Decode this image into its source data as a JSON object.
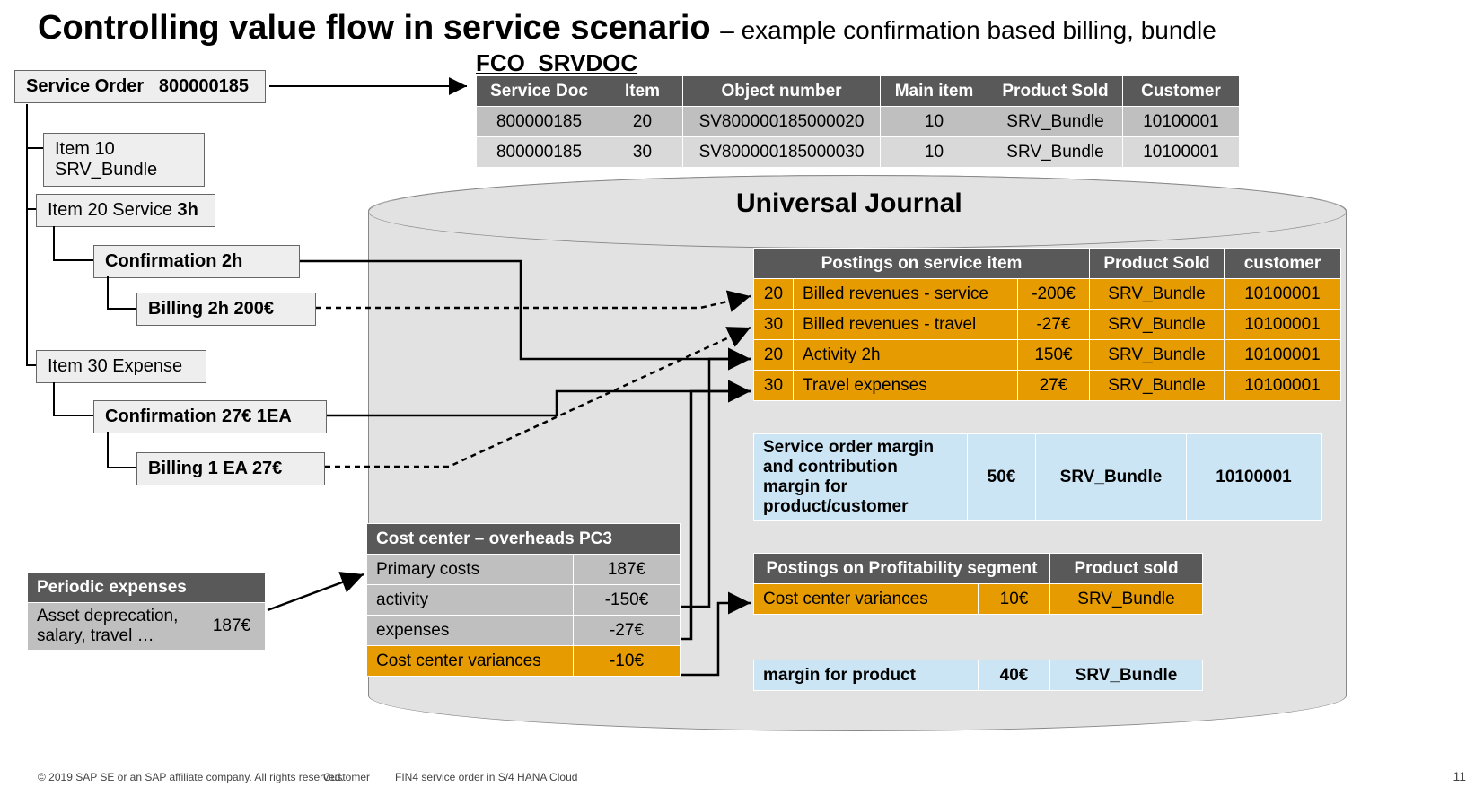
{
  "slide": {
    "title_main": "Controlling value flow in service scenario",
    "title_sub": "– example confirmation based billing, bundle",
    "service_order_label": "Service Order",
    "service_order_number": "800000185",
    "item10": "Item 10 SRV_Bundle",
    "item20_prefix": "Item 20   Service ",
    "item20_bold": "3h",
    "conf1": "Confirmation  2h",
    "bill1": "Billing 2h  200€",
    "item30": "Item 30   Expense",
    "conf2": "Confirmation  27€ 1EA",
    "bill2": "Billing 1 EA 27€",
    "periodic_header": "Periodic expenses",
    "periodic_desc": "Asset deprecation, salary, travel  …",
    "periodic_val": "187€",
    "fco_label": "FCO_SRVDOC",
    "uj_title": "Universal Journal",
    "footer_copyright": "© 2019 SAP SE or an SAP affiliate company. All rights reserved.",
    "footer_customer": "Customer",
    "footer_doc": "FIN4 service order in S/4 HANA Cloud",
    "footer_page": "11"
  },
  "fco_table": {
    "headers": [
      "Service Doc",
      "Item",
      "Object number",
      "Main item",
      "Product Sold",
      "Customer"
    ],
    "rows": [
      [
        "800000185",
        "20",
        "SV800000185000020",
        "10",
        "SRV_Bundle",
        "10100001"
      ],
      [
        "800000185",
        "30",
        "SV800000185000030",
        "10",
        "SRV_Bundle",
        "10100001"
      ]
    ]
  },
  "postings_table": {
    "h1": "Postings on service item",
    "h2": "Product Sold",
    "h3": "customer",
    "rows": [
      [
        "20",
        "Billed revenues - service",
        "-200€",
        "SRV_Bundle",
        "10100001"
      ],
      [
        "30",
        "Billed revenues - travel",
        "-27€",
        "SRV_Bundle",
        "10100001"
      ],
      [
        "20",
        "Activity 2h",
        "150€",
        "SRV_Bundle",
        "10100001"
      ],
      [
        "30",
        "Travel expenses",
        "27€",
        "SRV_Bundle",
        "10100001"
      ]
    ]
  },
  "margin1": {
    "label": "Service order margin and contribution margin for product/customer",
    "val": "50€",
    "prod": "SRV_Bundle",
    "cust": "10100001"
  },
  "costcenter": {
    "header": "Cost center – overheads  PC3",
    "rows": [
      [
        "Primary costs",
        "187€"
      ],
      [
        "activity",
        "-150€"
      ],
      [
        "expenses",
        "-27€"
      ],
      [
        "Cost center variances",
        "-10€"
      ]
    ]
  },
  "profseg": {
    "h1": "Postings on Profitability segment",
    "h2": "Product sold",
    "row": [
      "Cost center variances",
      "10€",
      "SRV_Bundle"
    ]
  },
  "margin2": {
    "label": "margin for product",
    "val": "40€",
    "prod": "SRV_Bundle"
  }
}
